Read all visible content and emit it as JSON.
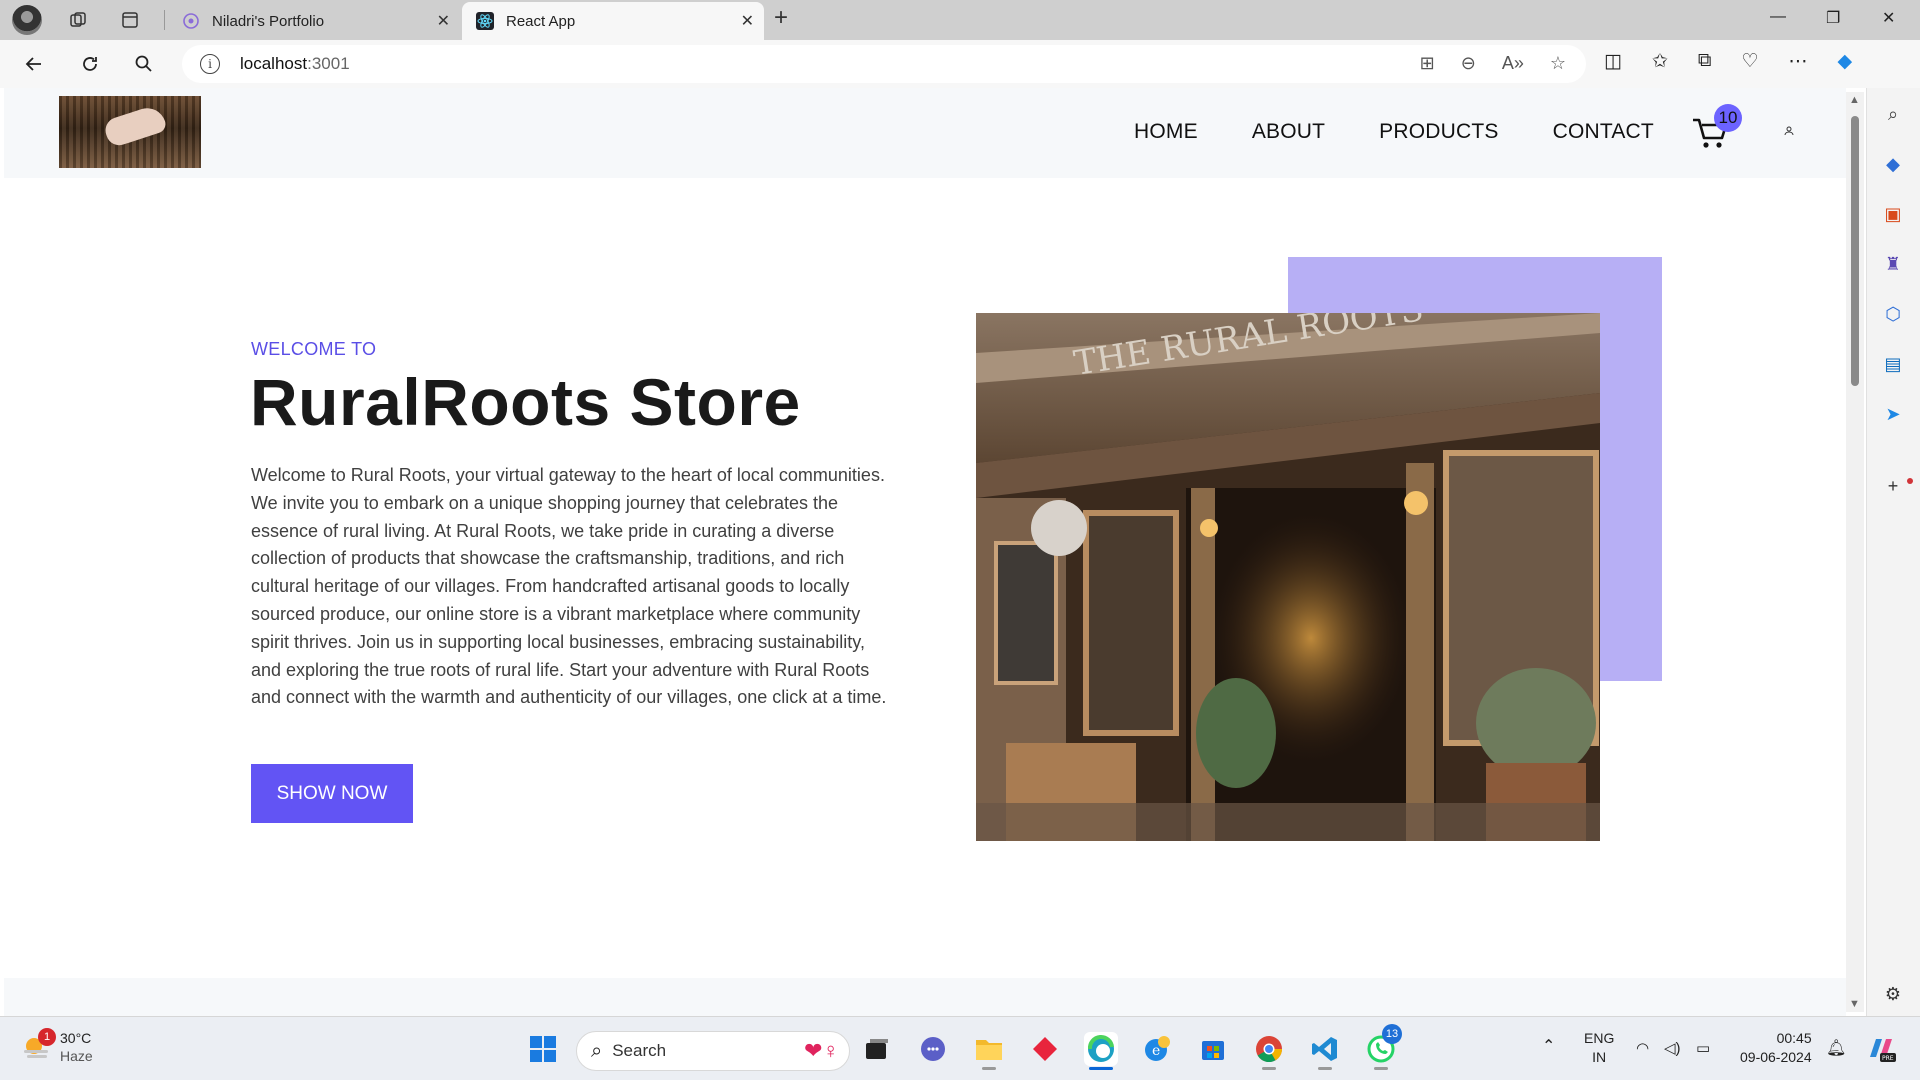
{
  "browser": {
    "tabs": [
      {
        "title": "Niladri's Portfolio",
        "active": false
      },
      {
        "title": "React App",
        "active": true
      }
    ],
    "url_host": "localhost",
    "url_port": ":3001"
  },
  "site": {
    "nav": [
      {
        "label": "HOME"
      },
      {
        "label": "ABOUT"
      },
      {
        "label": "PRODUCTS"
      },
      {
        "label": "CONTACT"
      }
    ],
    "cart_count": "10",
    "hero": {
      "welcome": "WELCOME TO",
      "title": "RuralRoots Store",
      "description": "Welcome to Rural Roots, your virtual gateway to the heart of local communities. We invite you to embark on a unique shopping journey that celebrates the essence of rural living. At Rural Roots, we take pride in curating a diverse collection of products that showcase the craftsmanship, traditions, and rich cultural heritage of our villages. From handcrafted artisanal goods to locally sourced produce, our online store is a vibrant marketplace where community spirit thrives. Join us in supporting local businesses, embracing sustainability, and exploring the true roots of rural life. Start your adventure with Rural Roots and connect with the warmth and authenticity of our villages, one click at a time.",
      "button": "SHOW NOW",
      "sign_text": "THE RURAL ROOTS"
    },
    "colors": {
      "accent": "#6254f4",
      "accent_light": "#b7aff5"
    }
  },
  "taskbar": {
    "weather_temp": "30°C",
    "weather_cond": "Haze",
    "weather_alerts": "1",
    "search_label": "Search",
    "whatsapp_badge": "13",
    "lang_top": "ENG",
    "lang_bottom": "IN",
    "time": "00:45",
    "date": "09-06-2024"
  }
}
